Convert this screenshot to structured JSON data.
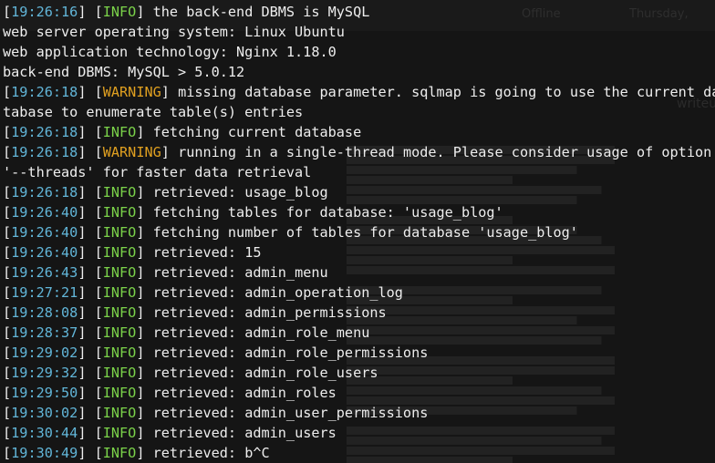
{
  "colors": {
    "background": "#151515",
    "text": "#eeeeee",
    "timestamp": "#62b6d9",
    "info": "#7bd34a",
    "warning": "#e0a020"
  },
  "background_window": {
    "status_offline": "Offline",
    "date": "Thursday,",
    "side_text": "writeu"
  },
  "lines": [
    {
      "time": "19:26:16",
      "level": "INFO",
      "msg": "the back-end DBMS is MySQL"
    },
    {
      "text": "web server operating system: Linux Ubuntu"
    },
    {
      "text": "web application technology: Nginx 1.18.0"
    },
    {
      "text": "back-end DBMS: MySQL > 5.0.12"
    },
    {
      "time": "19:26:18",
      "level": "WARNING",
      "msg": "missing database parameter. sqlmap is going to use the current da"
    },
    {
      "text": "tabase to enumerate table(s) entries"
    },
    {
      "time": "19:26:18",
      "level": "INFO",
      "msg": "fetching current database"
    },
    {
      "time": "19:26:18",
      "level": "WARNING",
      "msg": "running in a single-thread mode. Please consider usage of option"
    },
    {
      "text": "'--threads' for faster data retrieval"
    },
    {
      "time": "19:26:18",
      "level": "INFO",
      "msg": "retrieved: usage_blog"
    },
    {
      "time": "19:26:40",
      "level": "INFO",
      "msg": "fetching tables for database: 'usage_blog'"
    },
    {
      "time": "19:26:40",
      "level": "INFO",
      "msg": "fetching number of tables for database 'usage_blog'"
    },
    {
      "time": "19:26:40",
      "level": "INFO",
      "msg": "retrieved: 15"
    },
    {
      "time": "19:26:43",
      "level": "INFO",
      "msg": "retrieved: admin_menu"
    },
    {
      "time": "19:27:21",
      "level": "INFO",
      "msg": "retrieved: admin_operation_log"
    },
    {
      "time": "19:28:08",
      "level": "INFO",
      "msg": "retrieved: admin_permissions"
    },
    {
      "time": "19:28:37",
      "level": "INFO",
      "msg": "retrieved: admin_role_menu"
    },
    {
      "time": "19:29:02",
      "level": "INFO",
      "msg": "retrieved: admin_role_permissions"
    },
    {
      "time": "19:29:32",
      "level": "INFO",
      "msg": "retrieved: admin_role_users"
    },
    {
      "time": "19:29:50",
      "level": "INFO",
      "msg": "retrieved: admin_roles"
    },
    {
      "time": "19:30:02",
      "level": "INFO",
      "msg": "retrieved: admin_user_permissions"
    },
    {
      "time": "19:30:44",
      "level": "INFO",
      "msg": "retrieved: admin_users"
    },
    {
      "time": "19:30:49",
      "level": "INFO",
      "msg": "retrieved: b^C"
    }
  ]
}
